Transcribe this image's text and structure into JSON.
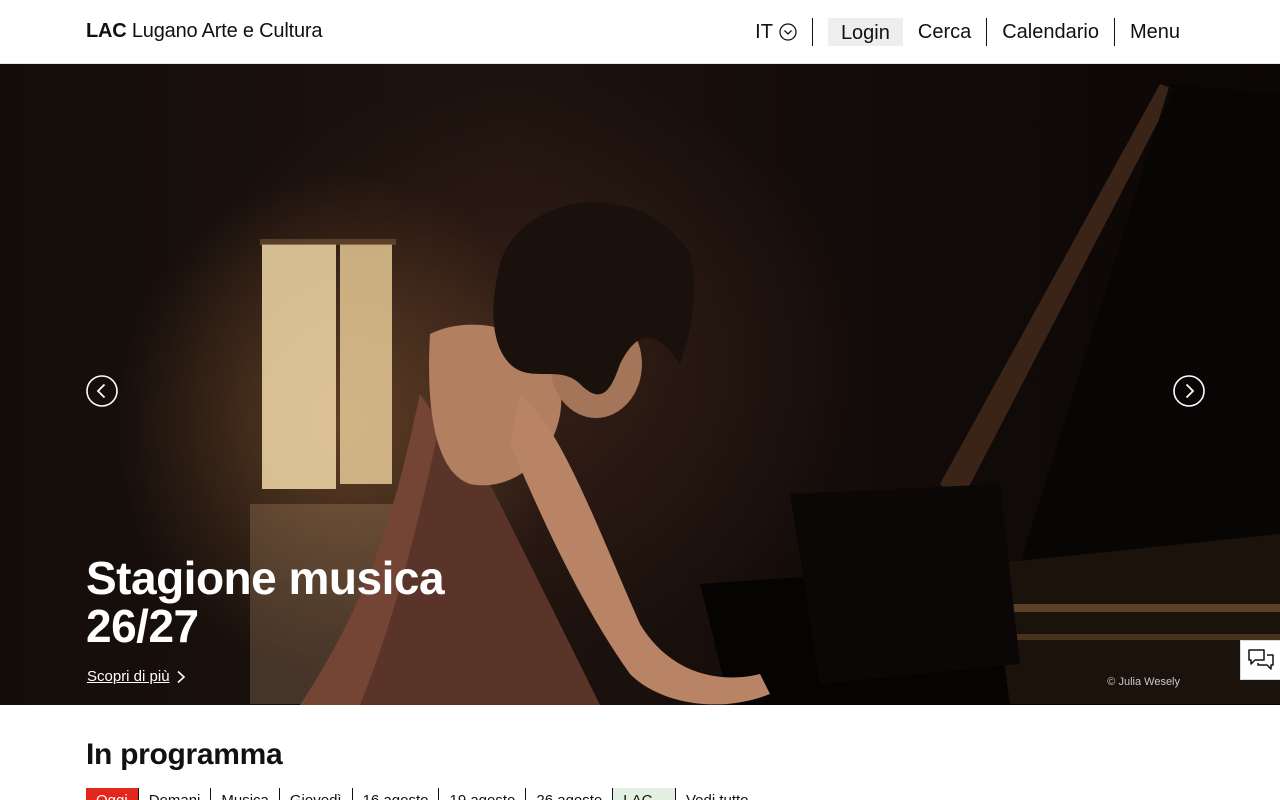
{
  "header": {
    "brand_bold": "LAC",
    "brand_rest": "Lugano Arte e Cultura",
    "nav": {
      "lang": "IT",
      "login": "Login",
      "search": "Cerca",
      "calendar": "Calendario",
      "menu": "Menu"
    }
  },
  "hero": {
    "title_line1": "Stagione musica",
    "title_line2": "26/27",
    "link_label": "Scopri di più",
    "credit": "© Julia Wesely"
  },
  "programme": {
    "title": "In programma",
    "filters": [
      "Oggi",
      "Domani",
      "Musica",
      "Giovedì",
      "16 agosto",
      "19 agosto",
      "26 agosto",
      "LAC...",
      "Vedi tutto"
    ]
  },
  "icons": {
    "lang": "chevron-down-circle-icon",
    "prev": "chevron-left-circle-icon",
    "next": "chevron-right-circle-icon",
    "link": "chevron-right-icon",
    "chat": "chat-bubbles-icon"
  },
  "colors": {
    "accent": "#e3271c",
    "lac_filter": "#e3efe3",
    "login_bg": "#eeeeee"
  }
}
